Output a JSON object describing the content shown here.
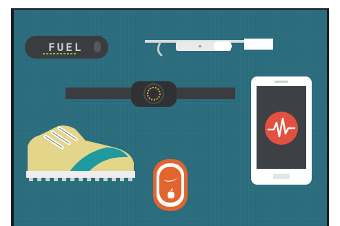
{
  "colors": {
    "frame": "#1c1c1c",
    "background": "#2a6b7c",
    "grid": "#3a7d8e",
    "band_dark": "#3a3c3f",
    "fuel_green": "#7ec243",
    "watch_accent": "#f0b43a",
    "phone_red": "#e2513f",
    "shoe_yellow": "#e3d58a",
    "shoe_teal": "#1f9aa0",
    "pod_orange": "#e2652f"
  },
  "illustration": {
    "fuel_band": {
      "label": "FUEL",
      "icon": "fuelband-icon"
    },
    "glasses": {
      "icon": "smart-glasses-icon"
    },
    "watch": {
      "icon": "smartwatch-icon"
    },
    "phone": {
      "icon": "smartphone-heartbeat-icon"
    },
    "shoe": {
      "icon": "running-shoe-icon"
    },
    "pod": {
      "icon": "nike-plus-sensor-icon"
    }
  }
}
